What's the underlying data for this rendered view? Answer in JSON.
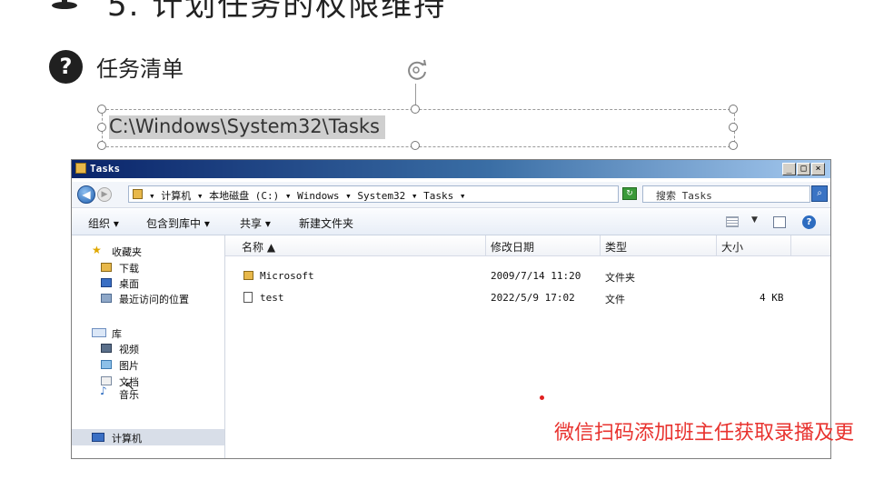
{
  "slide": {
    "heading_partial": "5. 计划任务的权限维持",
    "task_section_title": "任务清单",
    "question_icon": "?",
    "textbox_path": "C:\\Windows\\System32\\Tasks"
  },
  "window": {
    "title": "Tasks",
    "controls": {
      "minimize": "_",
      "maximize": "□",
      "close": "×"
    },
    "address_crumbs": "▾ 计算机 ▾ 本地磁盘 (C:) ▾ Windows ▾ System32 ▾ Tasks ▾",
    "search_placeholder": "搜索 Tasks",
    "toolbar": {
      "organize": "组织 ▾",
      "include_library": "包含到库中 ▾",
      "share": "共享 ▾",
      "new_folder": "新建文件夹"
    },
    "nav": {
      "favorites": "收藏夹",
      "downloads": "下载",
      "desktop": "桌面",
      "recent": "最近访问的位置",
      "libraries": "库",
      "videos": "视频",
      "pictures": "图片",
      "documents": "文档",
      "music": "音乐",
      "computer": "计算机"
    },
    "columns": {
      "name": "名称 ▲",
      "modified": "修改日期",
      "type": "类型",
      "size": "大小"
    },
    "files": [
      {
        "name": "Microsoft",
        "modified": "2009/7/14 11:20",
        "type": "文件夹",
        "size": ""
      },
      {
        "name": "test",
        "modified": "2022/5/9 17:02",
        "type": "文件",
        "size": "4 KB"
      }
    ]
  },
  "promo_text": "微信扫码添加班主任获取录播及更",
  "colors": {
    "promo": "#e8332f",
    "titlebar": "#0a246a"
  }
}
